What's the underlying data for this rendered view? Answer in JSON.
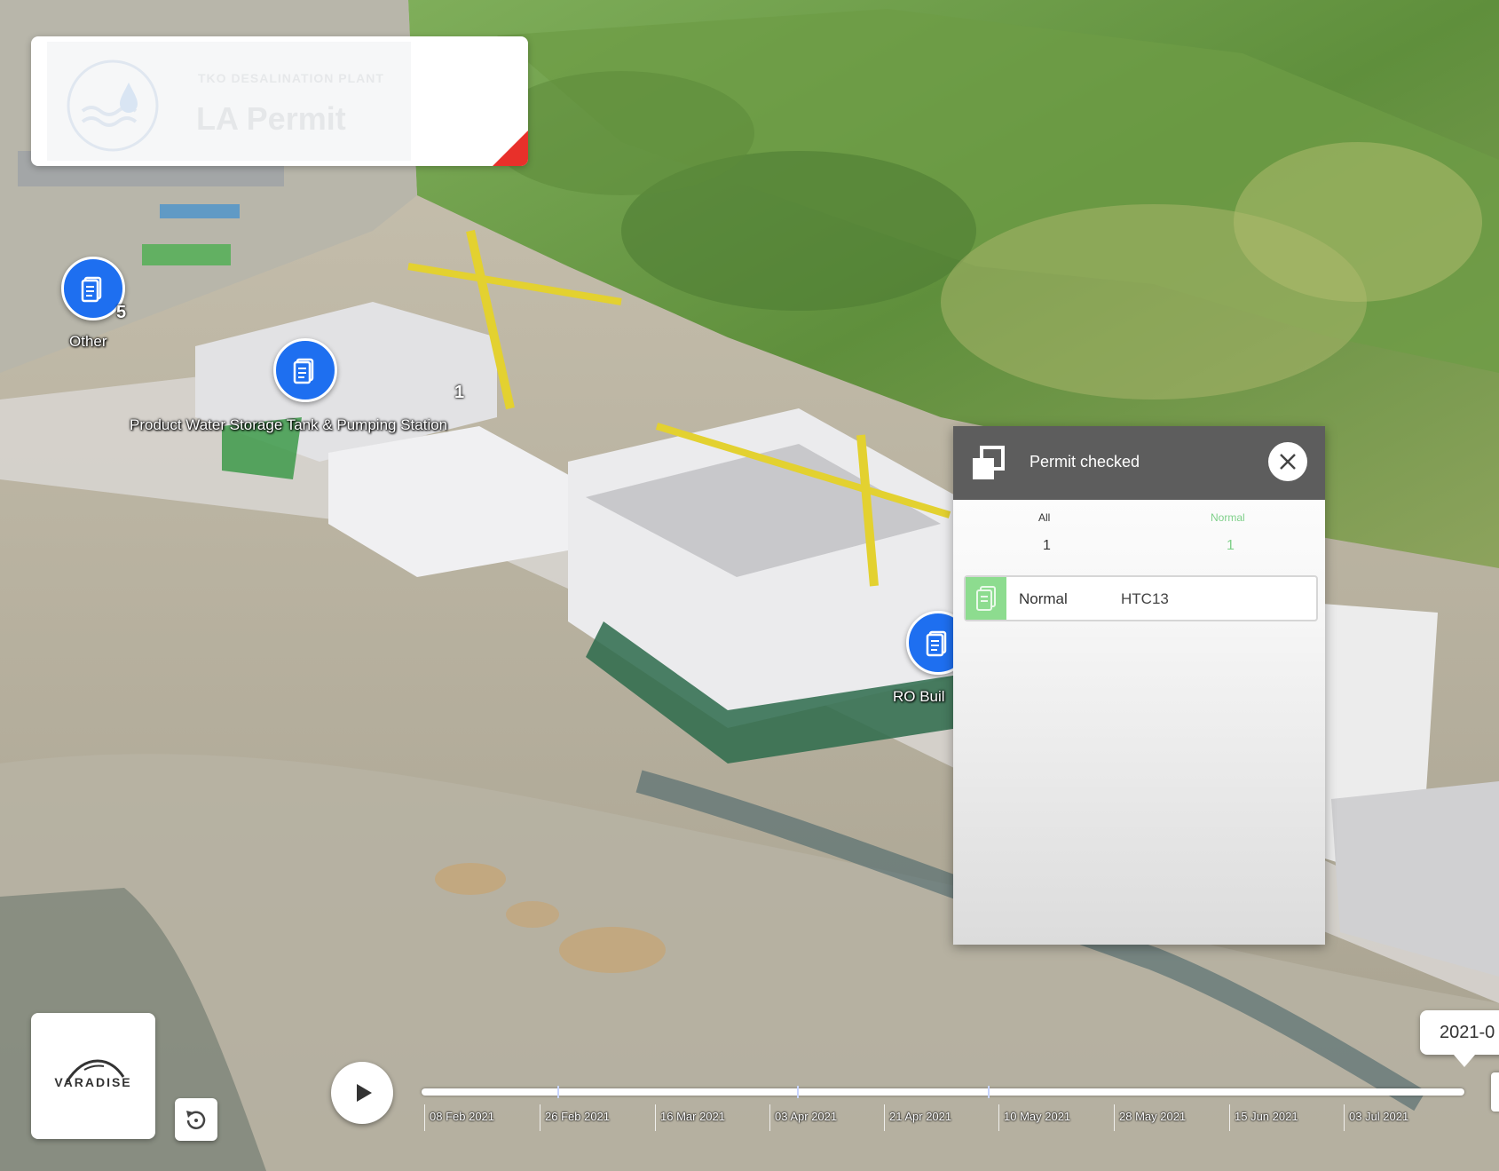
{
  "header": {
    "subtitle": "TKO DESALINATION PLANT",
    "title": "LA Permit",
    "logo_icon": "water-drop-waves-icon",
    "corner_color": "#e8302a"
  },
  "markers": [
    {
      "id": "other",
      "label": "Other",
      "count": "5",
      "icon": "document-icon"
    },
    {
      "id": "product-water",
      "label": "Product Water Storage Tank & Pumping Station",
      "count": "1",
      "icon": "document-icon"
    },
    {
      "id": "ro-building",
      "label": "RO Buil",
      "count": "",
      "icon": "document-icon"
    }
  ],
  "panel": {
    "title": "Permit checked",
    "header_icon": "copy-icon",
    "close_icon": "close-icon",
    "stats": {
      "all_label": "All",
      "all_value": "1",
      "normal_label": "Normal",
      "normal_value": "1"
    },
    "rows": [
      {
        "status": "Normal",
        "code": "HTC13",
        "icon": "document-icon",
        "status_color": "#8ddc8f"
      }
    ]
  },
  "brand": {
    "name": "VARADISE"
  },
  "timeline": {
    "current_date": "2021-0",
    "ticks": [
      "08 Feb 2021",
      "26 Feb 2021",
      "16 Mar 2021",
      "03 Apr 2021",
      "21 Apr 2021",
      "10 May 2021",
      "28 May 2021",
      "15 Jun 2021",
      "03 Jul 2021"
    ],
    "play_icon": "play-icon",
    "replay_icon": "replay-icon",
    "accent_color": "#c8d4ff"
  }
}
